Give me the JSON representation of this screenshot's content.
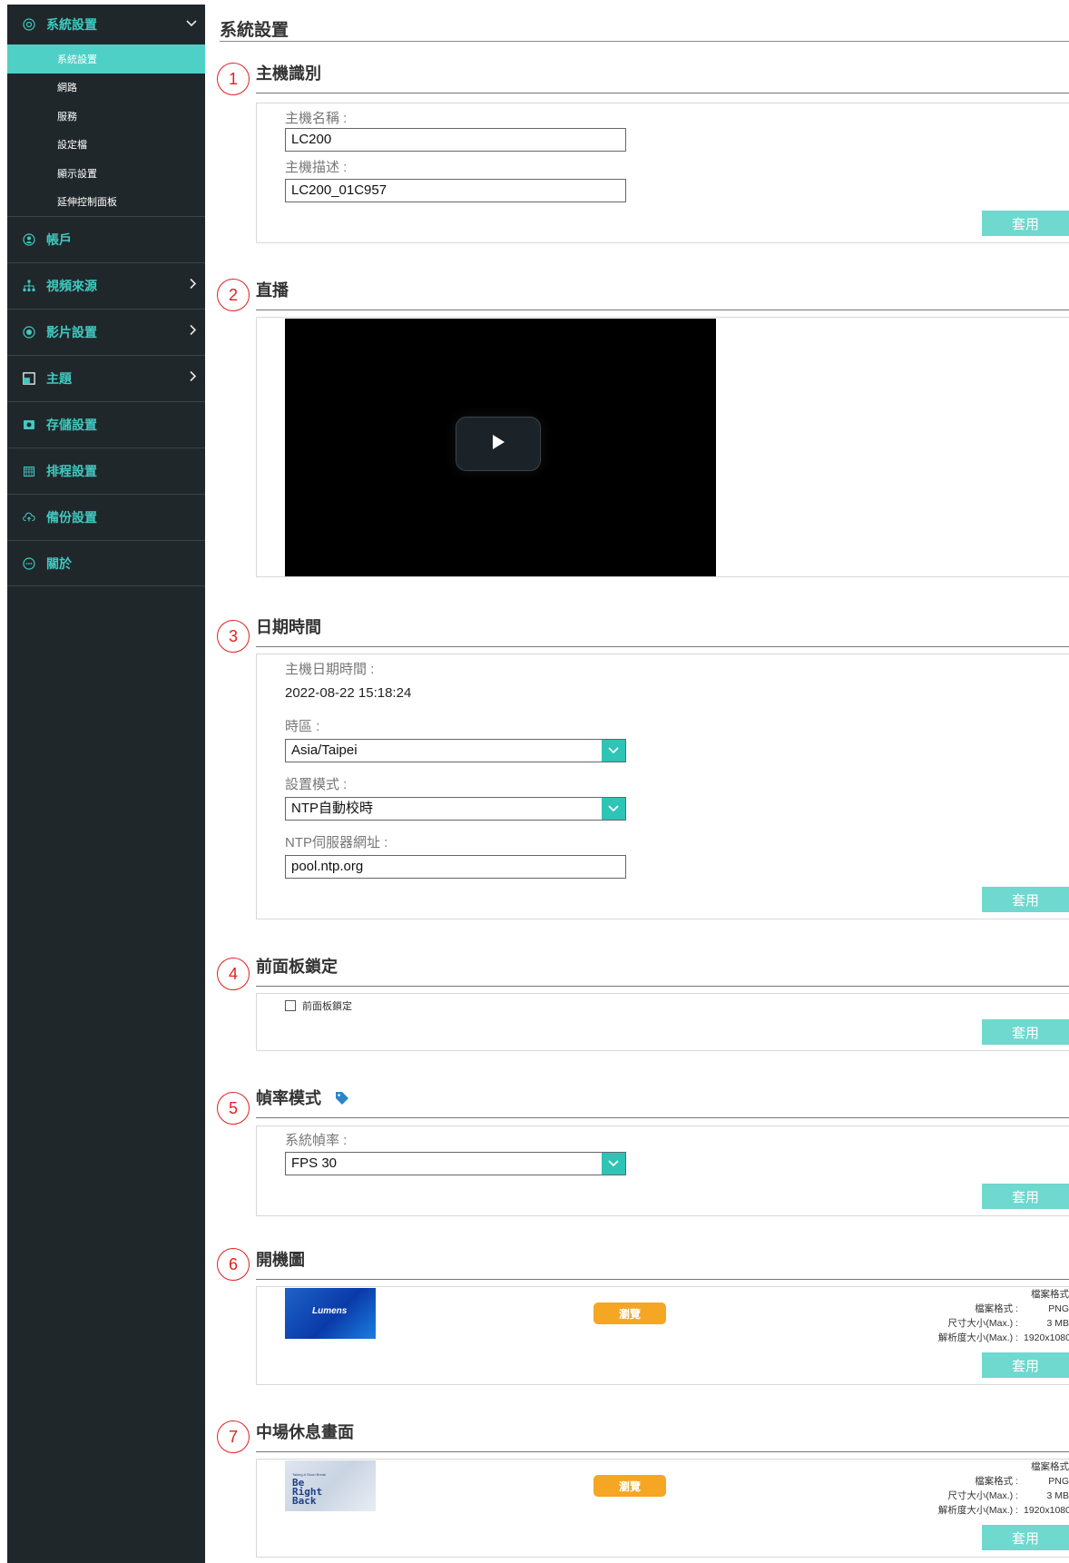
{
  "sidebar": {
    "group": {
      "label": "系統設置",
      "items": [
        "系統設置",
        "網路",
        "服務",
        "設定檔",
        "顯示設置",
        "延伸控制面板"
      ],
      "active_index": 0
    },
    "items": [
      {
        "label": "帳戶",
        "icon": "user-icon",
        "chevron": false
      },
      {
        "label": "視頻來源",
        "icon": "sitemap-icon",
        "chevron": true
      },
      {
        "label": "影片設置",
        "icon": "record-icon",
        "chevron": true
      },
      {
        "label": "主題",
        "icon": "layout-icon",
        "chevron": true
      },
      {
        "label": "存儲設置",
        "icon": "storage-icon",
        "chevron": false
      },
      {
        "label": "排程設置",
        "icon": "calendar-icon",
        "chevron": false
      },
      {
        "label": "備份設置",
        "icon": "upload-cloud-icon",
        "chevron": false
      },
      {
        "label": "關於",
        "icon": "info-chat-icon",
        "chevron": false
      }
    ]
  },
  "page": {
    "title": "系統設置"
  },
  "apply_label": "套用",
  "browse_label": "瀏覽",
  "sections": {
    "host": {
      "num": "1",
      "title": "主機識別",
      "name_label": "主機名稱 :",
      "name_value": "LC200",
      "desc_label": "主機描述 :",
      "desc_value": "LC200_01C957"
    },
    "live": {
      "num": "2",
      "title": "直播"
    },
    "datetime": {
      "num": "3",
      "title": "日期時間",
      "host_dt_label": "主機日期時間 :",
      "host_dt_value": "2022-08-22 15:18:24",
      "tz_label": "時區 :",
      "tz_value": "Asia/Taipei",
      "mode_label": "設置模式 :",
      "mode_value": "NTP自動校時",
      "ntp_label": "NTP伺服器網址 :",
      "ntp_value": "pool.ntp.org"
    },
    "lock": {
      "num": "4",
      "title": "前面板鎖定",
      "checkbox_label": "前面板鎖定",
      "checked": false
    },
    "fps": {
      "num": "5",
      "title": "幀率模式",
      "label": "系統幀率 :",
      "value": "FPS 30"
    },
    "boot": {
      "num": "6",
      "title": "開機圖",
      "thumb_text": "Lumens",
      "info_title": "檔案格式",
      "format_label": "檔案格式 :",
      "format_value": "PNG",
      "size_label": "尺寸大小(Max.) :",
      "size_value": "3 MB",
      "res_label": "解析度大小(Max.) :",
      "res_value": "1920x1080"
    },
    "break": {
      "num": "7",
      "title": "中場休息畫面",
      "thumb_text": "Be Right Back",
      "thumb_small": "Taking A Short Break",
      "info_title": "檔案格式",
      "format_label": "檔案格式 :",
      "format_value": "PNG",
      "size_label": "尺寸大小(Max.) :",
      "size_value": "3 MB",
      "res_label": "解析度大小(Max.) :",
      "res_value": "1920x1080"
    }
  }
}
